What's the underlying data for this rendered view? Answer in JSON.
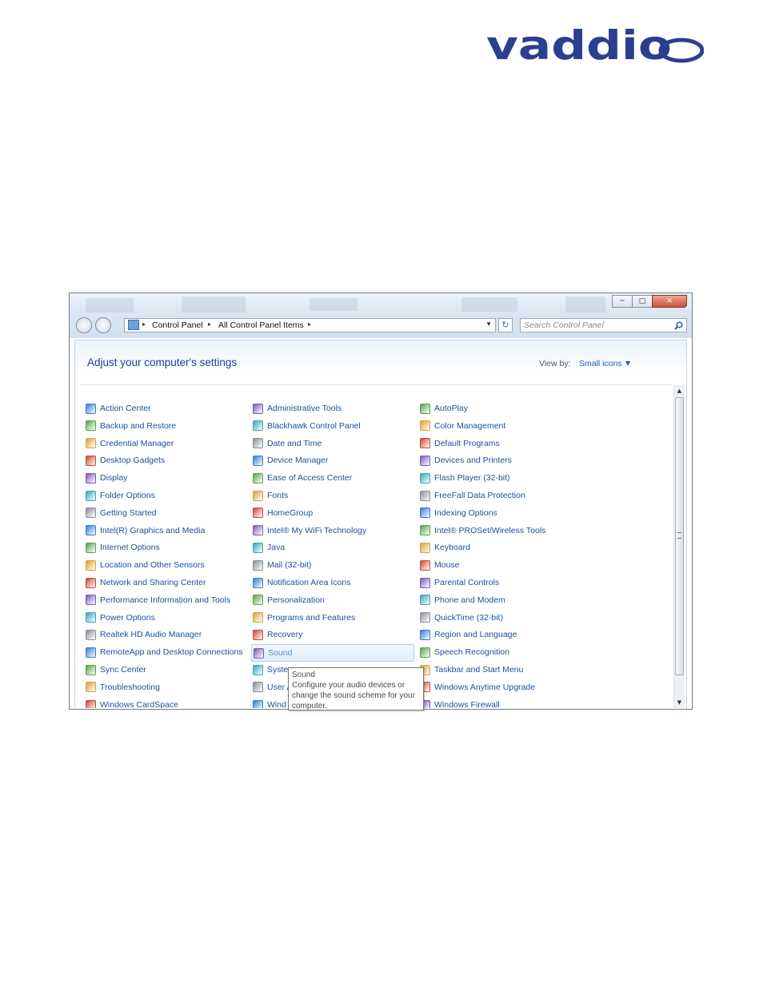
{
  "brand": {
    "logo_text": "vaddio",
    "color": "#2b3f8f"
  },
  "window": {
    "controls": [
      "minimize",
      "maximize",
      "close"
    ],
    "address_bar": {
      "crumbs": [
        "Control Panel",
        "All Control Panel Items"
      ]
    },
    "search": {
      "placeholder": "Search Control Panel"
    }
  },
  "content": {
    "heading": "Adjust your computer's settings",
    "view_by_label": "View by:",
    "view_by_value": "Small icons"
  },
  "items": {
    "col1": [
      {
        "label": "Action Center",
        "icon": "flag-icon"
      },
      {
        "label": "Backup and Restore",
        "icon": "backup-icon"
      },
      {
        "label": "Credential Manager",
        "icon": "credential-icon"
      },
      {
        "label": "Desktop Gadgets",
        "icon": "gadgets-icon"
      },
      {
        "label": "Display",
        "icon": "display-icon"
      },
      {
        "label": "Folder Options",
        "icon": "folder-icon"
      },
      {
        "label": "Getting Started",
        "icon": "getting-started-icon"
      },
      {
        "label": "Intel(R) Graphics and Media",
        "icon": "intel-graphics-icon"
      },
      {
        "label": "Internet Options",
        "icon": "internet-icon"
      },
      {
        "label": "Location and Other Sensors",
        "icon": "sensor-icon"
      },
      {
        "label": "Network and Sharing Center",
        "icon": "network-icon"
      },
      {
        "label": "Performance Information and Tools",
        "icon": "performance-icon"
      },
      {
        "label": "Power Options",
        "icon": "power-icon"
      },
      {
        "label": "Realtek HD Audio Manager",
        "icon": "realtek-icon"
      },
      {
        "label": "RemoteApp and Desktop Connections",
        "icon": "remoteapp-icon"
      },
      {
        "label": "Sync Center",
        "icon": "sync-icon"
      },
      {
        "label": "Troubleshooting",
        "icon": "troubleshooting-icon"
      },
      {
        "label": "Windows CardSpace",
        "icon": "cardspace-icon"
      }
    ],
    "col2": [
      {
        "label": "Administrative Tools",
        "icon": "admin-tools-icon"
      },
      {
        "label": "Blackhawk Control Panel",
        "icon": "blackhawk-icon"
      },
      {
        "label": "Date and Time",
        "icon": "clock-icon"
      },
      {
        "label": "Device Manager",
        "icon": "device-manager-icon"
      },
      {
        "label": "Ease of Access Center",
        "icon": "ease-of-access-icon"
      },
      {
        "label": "Fonts",
        "icon": "fonts-icon"
      },
      {
        "label": "HomeGroup",
        "icon": "homegroup-icon"
      },
      {
        "label": "Intel® My WiFi Technology",
        "icon": "wifi-icon"
      },
      {
        "label": "Java",
        "icon": "java-icon"
      },
      {
        "label": "Mail (32-bit)",
        "icon": "mail-icon"
      },
      {
        "label": "Notification Area Icons",
        "icon": "notification-icon"
      },
      {
        "label": "Personalization",
        "icon": "personalization-icon"
      },
      {
        "label": "Programs and Features",
        "icon": "programs-icon"
      },
      {
        "label": "Recovery",
        "icon": "recovery-icon"
      },
      {
        "label": "Sound",
        "icon": "speaker-icon"
      },
      {
        "label": "Syste",
        "icon": "system-icon"
      },
      {
        "label": "User A",
        "icon": "users-icon"
      },
      {
        "label": "Wind",
        "icon": "windows-icon"
      }
    ],
    "col3": [
      {
        "label": "AutoPlay",
        "icon": "autoplay-icon"
      },
      {
        "label": "Color Management",
        "icon": "color-management-icon"
      },
      {
        "label": "Default Programs",
        "icon": "default-programs-icon"
      },
      {
        "label": "Devices and Printers",
        "icon": "printer-icon"
      },
      {
        "label": "Flash Player (32-bit)",
        "icon": "flash-icon"
      },
      {
        "label": "FreeFall Data Protection",
        "icon": "freefall-icon"
      },
      {
        "label": "Indexing Options",
        "icon": "indexing-icon"
      },
      {
        "label": "Intel® PROSet/Wireless Tools",
        "icon": "proset-icon"
      },
      {
        "label": "Keyboard",
        "icon": "keyboard-icon"
      },
      {
        "label": "Mouse",
        "icon": "mouse-icon"
      },
      {
        "label": "Parental Controls",
        "icon": "parental-icon"
      },
      {
        "label": "Phone and Modem",
        "icon": "phone-icon"
      },
      {
        "label": "QuickTime (32-bit)",
        "icon": "quicktime-icon"
      },
      {
        "label": "Region and Language",
        "icon": "globe-icon"
      },
      {
        "label": "Speech Recognition",
        "icon": "microphone-icon"
      },
      {
        "label": "Taskbar and Start Menu",
        "icon": "taskbar-icon"
      },
      {
        "label": "Windows Anytime Upgrade",
        "icon": "upgrade-icon"
      },
      {
        "label": "Windows Firewall",
        "icon": "firewall-icon"
      }
    ]
  },
  "highlighted_item": "Sound",
  "tooltip": {
    "title": "Sound",
    "text": "Configure your audio devices or change the sound scheme for your computer."
  }
}
